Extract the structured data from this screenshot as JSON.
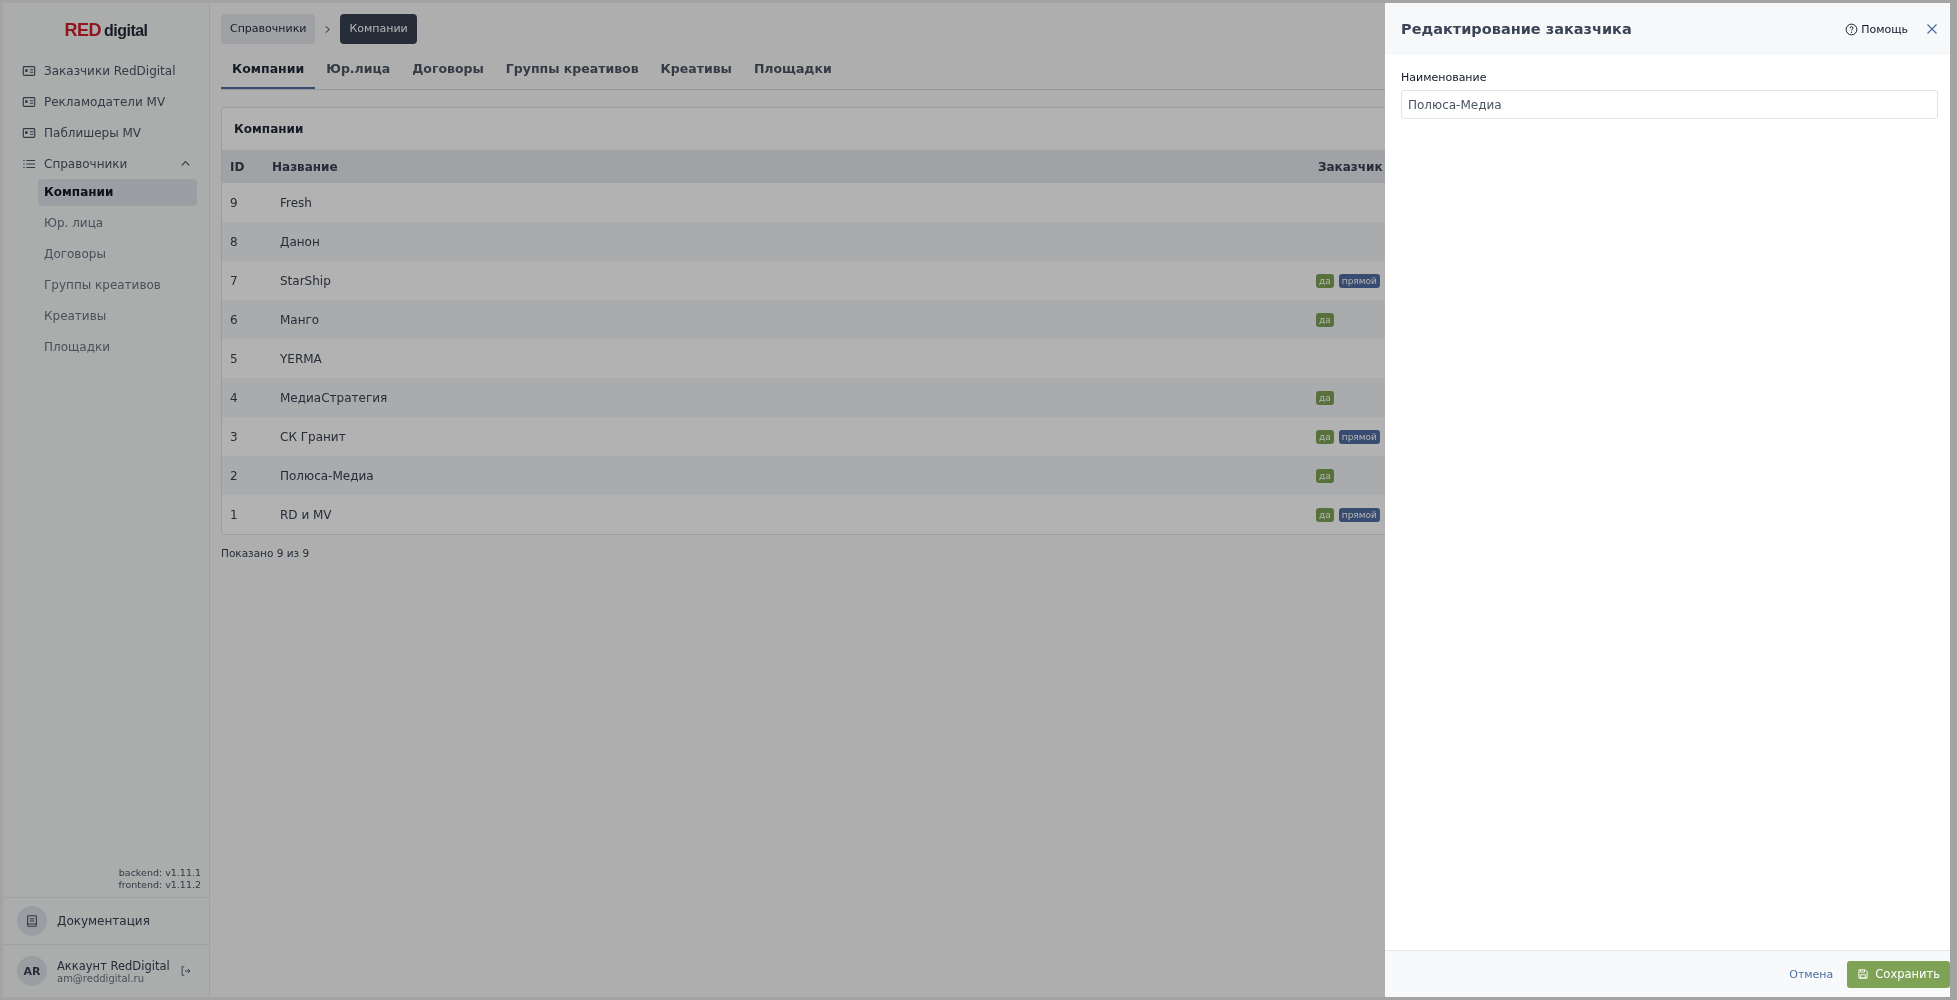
{
  "logo": {
    "bold": "RED",
    "rest": "digital"
  },
  "sidebar": {
    "items": [
      {
        "label": "Заказчики RedDigital",
        "kind": "card"
      },
      {
        "label": "Рекламодатели MV",
        "kind": "card"
      },
      {
        "label": "Паблишеры MV",
        "kind": "card"
      },
      {
        "label": "Справочники",
        "kind": "list",
        "expanded": true,
        "children": [
          {
            "label": "Компании",
            "selected": true
          },
          {
            "label": "Юр. лица",
            "selected": false
          },
          {
            "label": "Договоры",
            "selected": false
          },
          {
            "label": "Группы креативов",
            "selected": false
          },
          {
            "label": "Креативы",
            "selected": false
          },
          {
            "label": "Площадки",
            "selected": false
          }
        ]
      }
    ],
    "versions": [
      "backend: v1.11.1",
      "frontend: v1.11.2"
    ],
    "docs": "Документация",
    "account": {
      "initials": "AR",
      "name": "Аккаунт RedDigital",
      "email": "am@reddigital.ru"
    }
  },
  "breadcrumbs": [
    {
      "label": "Справочники",
      "selected": false
    },
    {
      "label": "Компании",
      "selected": true
    }
  ],
  "tabs": [
    {
      "label": "Компании",
      "selected": true
    },
    {
      "label": "Юр.лица",
      "selected": false
    },
    {
      "label": "Договоры",
      "selected": false
    },
    {
      "label": "Группы креативов",
      "selected": false
    },
    {
      "label": "Креативы",
      "selected": false
    },
    {
      "label": "Площадки",
      "selected": false
    }
  ],
  "table": {
    "title": "Компании",
    "columns": [
      "ID",
      "Название",
      "Заказчик"
    ],
    "rows": [
      {
        "id": "9",
        "name": "Fresh"
      },
      {
        "id": "8",
        "name": "Данон"
      },
      {
        "id": "7",
        "name": "StarShip",
        "tags": [
          {
            "text": "да",
            "kind": "yes"
          },
          {
            "text": "прямой",
            "kind": "direct"
          }
        ]
      },
      {
        "id": "6",
        "name": "Манго",
        "tags": [
          {
            "text": "да",
            "kind": "yes"
          }
        ]
      },
      {
        "id": "5",
        "name": "YERMA"
      },
      {
        "id": "4",
        "name": "МедиаСтратегия",
        "tags": [
          {
            "text": "да",
            "kind": "yes"
          }
        ]
      },
      {
        "id": "3",
        "name": "СК Гранит",
        "tags": [
          {
            "text": "да",
            "kind": "yes"
          },
          {
            "text": "прямой",
            "kind": "direct"
          }
        ]
      },
      {
        "id": "2",
        "name": "Полюса-Медиа",
        "tags": [
          {
            "text": "да",
            "kind": "yes"
          }
        ]
      },
      {
        "id": "1",
        "name": "RD и MV",
        "tags": [
          {
            "text": "да",
            "kind": "yes"
          },
          {
            "text": "прямой",
            "kind": "direct"
          }
        ]
      }
    ]
  },
  "footer": "Показано 9 из 9",
  "drawer": {
    "title": "Редактирование заказчика",
    "help": "Помощь",
    "field": {
      "label": "Наименование",
      "value": "Полюса-Медиа"
    },
    "cancel": "Отмена",
    "save": "Сохранить"
  }
}
